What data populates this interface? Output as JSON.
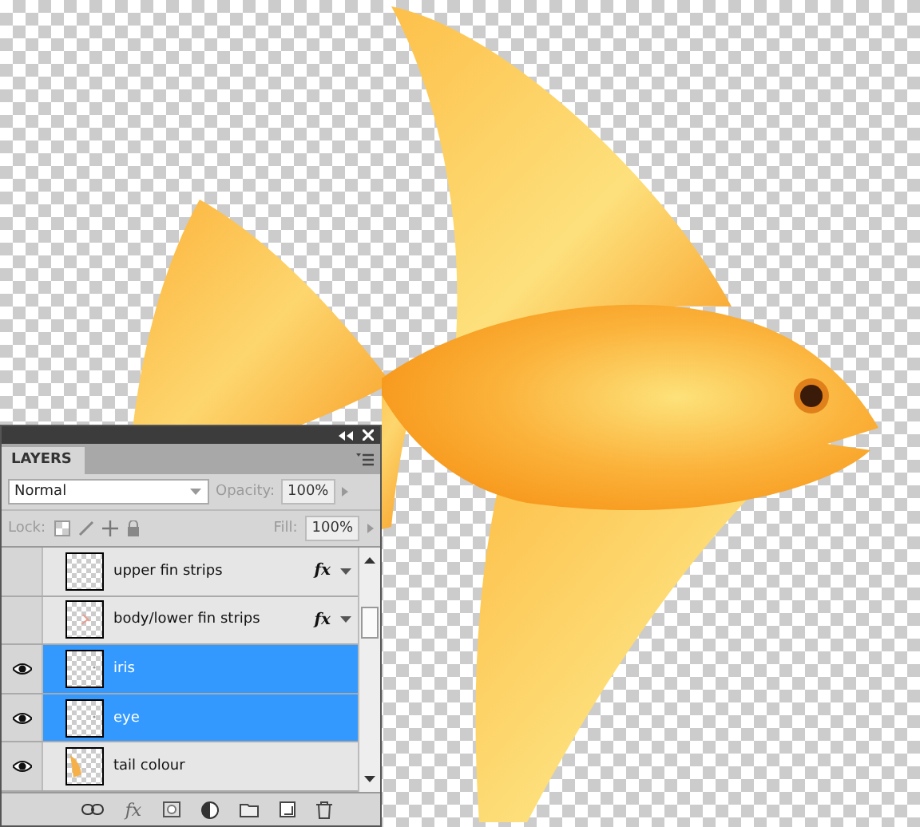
{
  "panel": {
    "title": "LAYERS",
    "blend_mode": "Normal",
    "opacity_label": "Opacity:",
    "opacity": "100%",
    "lock_label": "Lock:",
    "fill_label": "Fill:",
    "fill": "100%",
    "footer_fx": "fx"
  },
  "layers": [
    {
      "name": "upper fin strips",
      "visible": false,
      "selected": false,
      "effects": "fx",
      "kind": "empty"
    },
    {
      "name": "body/lower fin strips",
      "visible": false,
      "selected": false,
      "effects": "fx",
      "kind": "strokes"
    },
    {
      "name": "iris",
      "visible": true,
      "selected": true,
      "kind": "dot"
    },
    {
      "name": "eye",
      "visible": true,
      "selected": true,
      "kind": "dot"
    },
    {
      "name": "tail colour",
      "visible": true,
      "selected": false,
      "kind": "orange"
    }
  ]
}
